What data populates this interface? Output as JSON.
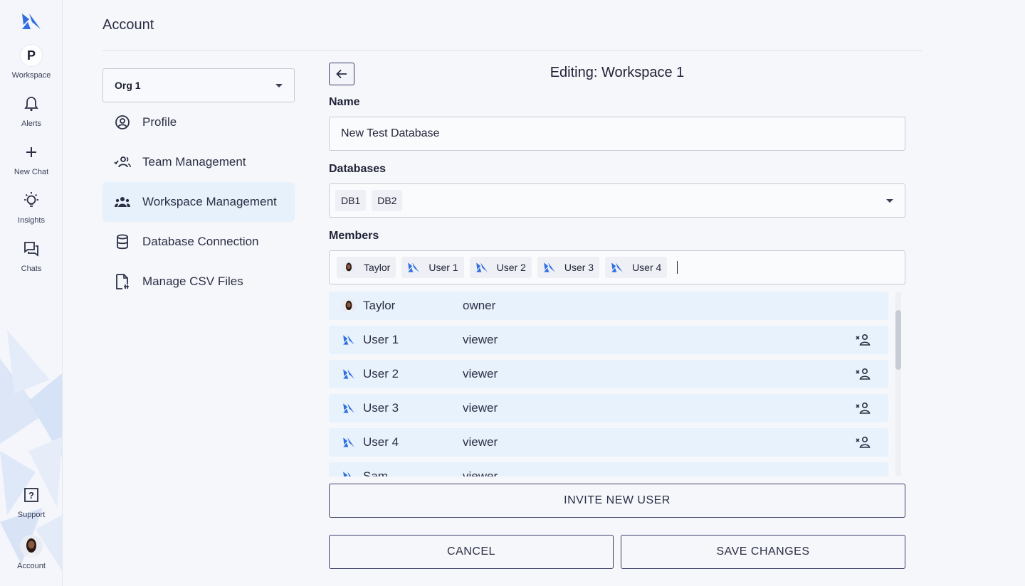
{
  "rail": {
    "workspace_initial": "P",
    "items": [
      {
        "label": "Workspace",
        "icon": "workspace-avatar"
      },
      {
        "label": "Alerts",
        "icon": "bell-icon"
      },
      {
        "label": "New Chat",
        "icon": "plus-icon"
      },
      {
        "label": "Insights",
        "icon": "lightbulb-icon"
      },
      {
        "label": "Chats",
        "icon": "chat-bubbles-icon"
      },
      {
        "label": "Support",
        "icon": "question-icon"
      },
      {
        "label": "Account",
        "icon": "user-avatar"
      }
    ]
  },
  "page": {
    "title": "Account"
  },
  "sidebar": {
    "org_select": "Org 1",
    "items": [
      {
        "label": "Profile",
        "icon": "user-circle-icon",
        "active": false
      },
      {
        "label": "Team Management",
        "icon": "team-check-icon",
        "active": false
      },
      {
        "label": "Workspace Management",
        "icon": "group-icon",
        "active": true
      },
      {
        "label": "Database Connection",
        "icon": "database-icon",
        "active": false
      },
      {
        "label": "Manage CSV Files",
        "icon": "csv-file-icon",
        "active": false
      }
    ]
  },
  "editor": {
    "title": "Editing: Workspace 1",
    "name_label": "Name",
    "name_value": "New Test Database",
    "databases_label": "Databases",
    "databases": [
      "DB1",
      "DB2"
    ],
    "members_label": "Members",
    "member_chips": [
      "Taylor",
      "User 1",
      "User 2",
      "User 3",
      "User 4"
    ],
    "members": [
      {
        "name": "Taylor",
        "role": "owner",
        "avatar": "photo"
      },
      {
        "name": "User 1",
        "role": "viewer",
        "avatar": "logo"
      },
      {
        "name": "User 2",
        "role": "viewer",
        "avatar": "logo"
      },
      {
        "name": "User 3",
        "role": "viewer",
        "avatar": "logo"
      },
      {
        "name": "User 4",
        "role": "viewer",
        "avatar": "logo"
      },
      {
        "name": "Sam",
        "role": "viewer",
        "avatar": "logo"
      }
    ],
    "invite_label": "INVITE NEW USER",
    "cancel_label": "CANCEL",
    "save_label": "SAVE CHANGES"
  },
  "colors": {
    "brand": "#2f6fe0",
    "active_bg": "#e6f1fc",
    "border": "#3a3f66"
  }
}
